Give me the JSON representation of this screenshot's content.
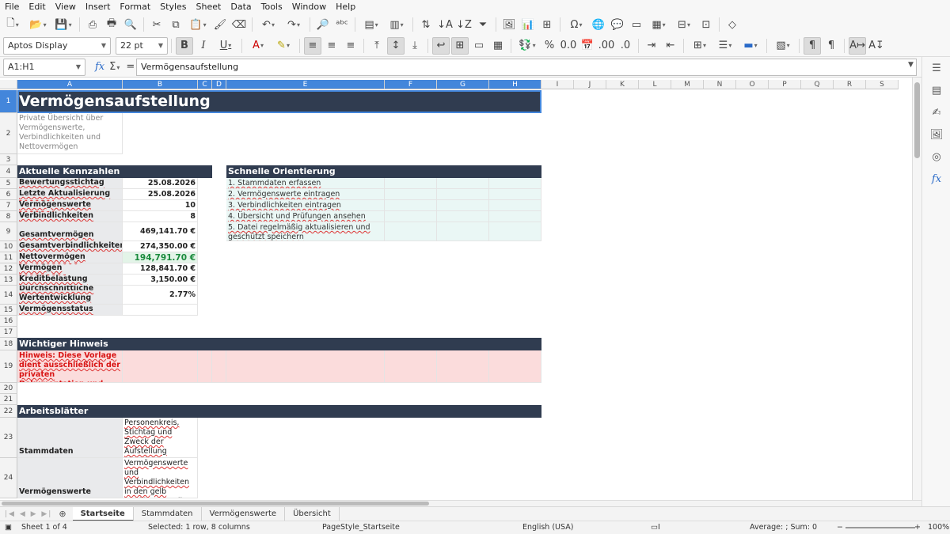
{
  "menu": [
    "File",
    "Edit",
    "View",
    "Insert",
    "Format",
    "Styles",
    "Sheet",
    "Data",
    "Tools",
    "Window",
    "Help"
  ],
  "toolbar": {
    "font_name": "Aptos Display",
    "font_size": "22 pt"
  },
  "formula_bar": {
    "name_box": "A1:H1",
    "formula": "Vermögensaufstellung"
  },
  "columns": [
    "A",
    "B",
    "C",
    "D",
    "E",
    "F",
    "G",
    "H",
    "I",
    "J",
    "K",
    "L",
    "M",
    "N",
    "O",
    "P",
    "Q",
    "R",
    "S"
  ],
  "rows": [
    "1",
    "2",
    "3",
    "4",
    "5",
    "6",
    "7",
    "8",
    "9",
    "10",
    "11",
    "12",
    "13",
    "14",
    "15",
    "16",
    "17",
    "18",
    "19",
    "20",
    "21",
    "22",
    "23",
    "24"
  ],
  "sheet": {
    "title": "Vermögensaufstellung",
    "subtitle": "Private Übersicht über Vermögenswerte, Verbindlichkeiten und Nettovermögen",
    "kpi_header": "Aktuelle Kennzahlen",
    "kpis": [
      {
        "label": "Bewertungsstichtag",
        "value": "25.08.2026"
      },
      {
        "label": "Letzte Aktualisierung",
        "value": "25.08.2026"
      },
      {
        "label": "Erfasste Vermögenswerte",
        "value": "10"
      },
      {
        "label": "Erfasste Verbindlichkeiten",
        "value": "8"
      },
      {
        "label": "Gesamtvermögen",
        "value": "469,141.70 €"
      },
      {
        "label": "Gesamtverbindlichkeiten",
        "value": "274,350.00 €"
      },
      {
        "label": "Nettovermögen",
        "value": "194,791.70 €"
      },
      {
        "label": "Liquidierbares Vermögen",
        "value": "128,841.70 €"
      },
      {
        "label": "Monatliche Kreditbelastung",
        "value": "3,150.00 €"
      },
      {
        "label": "Durchschnittliche Wertentwicklung",
        "value": "2.77%"
      },
      {
        "label": "Vermögensstatus",
        "value": ""
      }
    ],
    "guide_header": "Schnelle Orientierung",
    "guide": [
      "1. Stammdaten erfassen",
      "2. Vermögenswerte eintragen",
      "3. Verbindlichkeiten eintragen",
      "4. Übersicht und Prüfungen ansehen",
      "5. Datei regelmäßig aktualisieren und geschützt speichern"
    ],
    "notice_header": "Wichtiger Hinweis",
    "notice_text": "Hinweis: Diese Vorlage dient ausschließlich der privaten Dokumentation und",
    "sheets_header": "Arbeitsblätter",
    "sheets": [
      {
        "name": "Stammdaten",
        "desc": "Personenkreis, Stichtag und Zweck der Aufstellung eingeben."
      },
      {
        "name": "Vermögenswerte",
        "desc": "Vermögenswerte und Verbindlichkeiten in den gelb markierten Zellen erfassen."
      }
    ]
  },
  "tabs": [
    "Startseite",
    "Stammdaten",
    "Vermögenswerte",
    "Übersicht"
  ],
  "status": {
    "sheet": "Sheet 1 of 4",
    "selection": "Selected: 1 row, 8 columns",
    "page_style": "PageStyle_Startseite",
    "language": "English (USA)",
    "summary": "Average: ; Sum: 0",
    "zoom": "100%"
  },
  "colors": {
    "header_bg": "#303c50",
    "selection": "#4386db",
    "net_green": "#1a8a3d",
    "warning_bg": "#fbdcdc"
  }
}
